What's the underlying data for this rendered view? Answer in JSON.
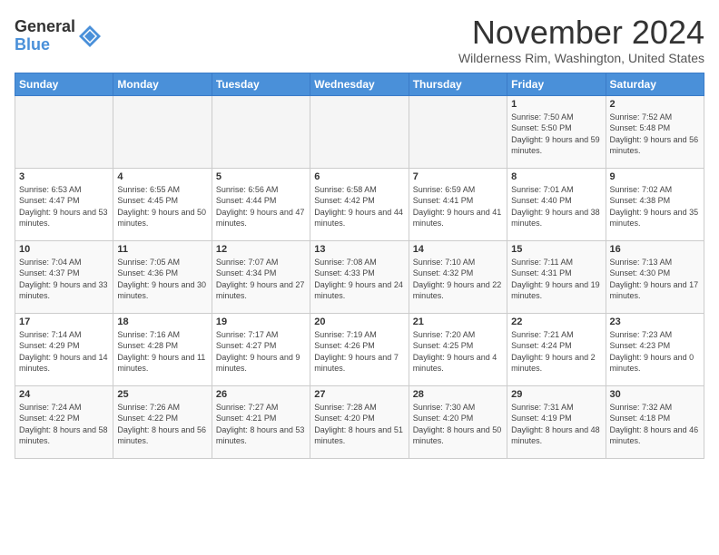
{
  "header": {
    "logo_line1": "General",
    "logo_line2": "Blue",
    "title": "November 2024",
    "subtitle": "Wilderness Rim, Washington, United States"
  },
  "days_of_week": [
    "Sunday",
    "Monday",
    "Tuesday",
    "Wednesday",
    "Thursday",
    "Friday",
    "Saturday"
  ],
  "weeks": [
    [
      {
        "day": "",
        "info": ""
      },
      {
        "day": "",
        "info": ""
      },
      {
        "day": "",
        "info": ""
      },
      {
        "day": "",
        "info": ""
      },
      {
        "day": "",
        "info": ""
      },
      {
        "day": "1",
        "info": "Sunrise: 7:50 AM\nSunset: 5:50 PM\nDaylight: 9 hours and 59 minutes."
      },
      {
        "day": "2",
        "info": "Sunrise: 7:52 AM\nSunset: 5:48 PM\nDaylight: 9 hours and 56 minutes."
      }
    ],
    [
      {
        "day": "3",
        "info": "Sunrise: 6:53 AM\nSunset: 4:47 PM\nDaylight: 9 hours and 53 minutes."
      },
      {
        "day": "4",
        "info": "Sunrise: 6:55 AM\nSunset: 4:45 PM\nDaylight: 9 hours and 50 minutes."
      },
      {
        "day": "5",
        "info": "Sunrise: 6:56 AM\nSunset: 4:44 PM\nDaylight: 9 hours and 47 minutes."
      },
      {
        "day": "6",
        "info": "Sunrise: 6:58 AM\nSunset: 4:42 PM\nDaylight: 9 hours and 44 minutes."
      },
      {
        "day": "7",
        "info": "Sunrise: 6:59 AM\nSunset: 4:41 PM\nDaylight: 9 hours and 41 minutes."
      },
      {
        "day": "8",
        "info": "Sunrise: 7:01 AM\nSunset: 4:40 PM\nDaylight: 9 hours and 38 minutes."
      },
      {
        "day": "9",
        "info": "Sunrise: 7:02 AM\nSunset: 4:38 PM\nDaylight: 9 hours and 35 minutes."
      }
    ],
    [
      {
        "day": "10",
        "info": "Sunrise: 7:04 AM\nSunset: 4:37 PM\nDaylight: 9 hours and 33 minutes."
      },
      {
        "day": "11",
        "info": "Sunrise: 7:05 AM\nSunset: 4:36 PM\nDaylight: 9 hours and 30 minutes."
      },
      {
        "day": "12",
        "info": "Sunrise: 7:07 AM\nSunset: 4:34 PM\nDaylight: 9 hours and 27 minutes."
      },
      {
        "day": "13",
        "info": "Sunrise: 7:08 AM\nSunset: 4:33 PM\nDaylight: 9 hours and 24 minutes."
      },
      {
        "day": "14",
        "info": "Sunrise: 7:10 AM\nSunset: 4:32 PM\nDaylight: 9 hours and 22 minutes."
      },
      {
        "day": "15",
        "info": "Sunrise: 7:11 AM\nSunset: 4:31 PM\nDaylight: 9 hours and 19 minutes."
      },
      {
        "day": "16",
        "info": "Sunrise: 7:13 AM\nSunset: 4:30 PM\nDaylight: 9 hours and 17 minutes."
      }
    ],
    [
      {
        "day": "17",
        "info": "Sunrise: 7:14 AM\nSunset: 4:29 PM\nDaylight: 9 hours and 14 minutes."
      },
      {
        "day": "18",
        "info": "Sunrise: 7:16 AM\nSunset: 4:28 PM\nDaylight: 9 hours and 11 minutes."
      },
      {
        "day": "19",
        "info": "Sunrise: 7:17 AM\nSunset: 4:27 PM\nDaylight: 9 hours and 9 minutes."
      },
      {
        "day": "20",
        "info": "Sunrise: 7:19 AM\nSunset: 4:26 PM\nDaylight: 9 hours and 7 minutes."
      },
      {
        "day": "21",
        "info": "Sunrise: 7:20 AM\nSunset: 4:25 PM\nDaylight: 9 hours and 4 minutes."
      },
      {
        "day": "22",
        "info": "Sunrise: 7:21 AM\nSunset: 4:24 PM\nDaylight: 9 hours and 2 minutes."
      },
      {
        "day": "23",
        "info": "Sunrise: 7:23 AM\nSunset: 4:23 PM\nDaylight: 9 hours and 0 minutes."
      }
    ],
    [
      {
        "day": "24",
        "info": "Sunrise: 7:24 AM\nSunset: 4:22 PM\nDaylight: 8 hours and 58 minutes."
      },
      {
        "day": "25",
        "info": "Sunrise: 7:26 AM\nSunset: 4:22 PM\nDaylight: 8 hours and 56 minutes."
      },
      {
        "day": "26",
        "info": "Sunrise: 7:27 AM\nSunset: 4:21 PM\nDaylight: 8 hours and 53 minutes."
      },
      {
        "day": "27",
        "info": "Sunrise: 7:28 AM\nSunset: 4:20 PM\nDaylight: 8 hours and 51 minutes."
      },
      {
        "day": "28",
        "info": "Sunrise: 7:30 AM\nSunset: 4:20 PM\nDaylight: 8 hours and 50 minutes."
      },
      {
        "day": "29",
        "info": "Sunrise: 7:31 AM\nSunset: 4:19 PM\nDaylight: 8 hours and 48 minutes."
      },
      {
        "day": "30",
        "info": "Sunrise: 7:32 AM\nSunset: 4:18 PM\nDaylight: 8 hours and 46 minutes."
      }
    ]
  ]
}
